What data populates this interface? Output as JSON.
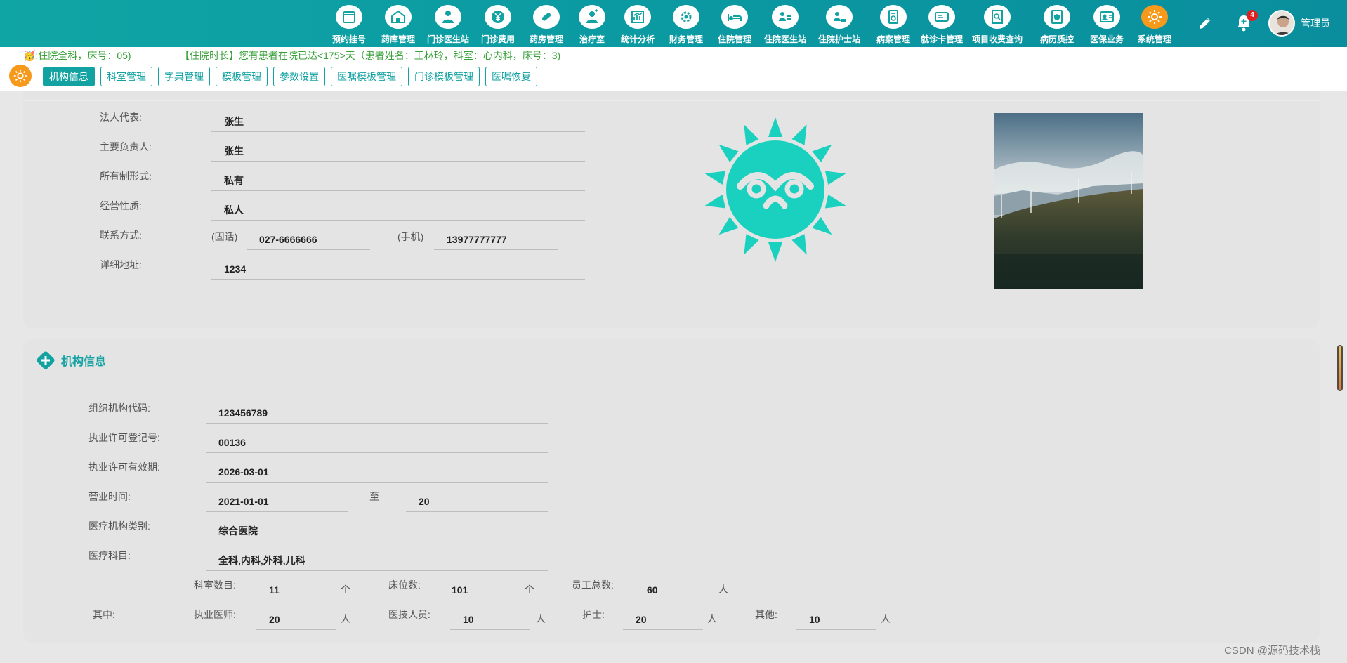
{
  "nav": {
    "items": [
      {
        "label": "预约挂号",
        "icon": "calendar-icon"
      },
      {
        "label": "药库管理",
        "icon": "warehouse-icon"
      },
      {
        "label": "门诊医生站",
        "icon": "doctor-icon"
      },
      {
        "label": "门诊费用",
        "icon": "yen-icon"
      },
      {
        "label": "药房管理",
        "icon": "pill-icon"
      },
      {
        "label": "治疗室",
        "icon": "nurse-icon"
      },
      {
        "label": "统计分析",
        "icon": "chart-icon"
      },
      {
        "label": "财务管理",
        "icon": "finance-gear-icon"
      },
      {
        "label": "住院管理",
        "icon": "bed-icon"
      },
      {
        "label": "住院医生站",
        "icon": "inpatient-doctor-icon"
      },
      {
        "label": "住院护士站",
        "icon": "inpatient-nurse-icon"
      },
      {
        "label": "病案管理",
        "icon": "record-icon"
      },
      {
        "label": "就诊卡管理",
        "icon": "card-icon"
      },
      {
        "label": "项目收费查询",
        "icon": "search-doc-icon"
      },
      {
        "label": "病历质控",
        "icon": "shield-doc-icon"
      },
      {
        "label": "医保业务",
        "icon": "insurance-icon"
      },
      {
        "label": "系统管理",
        "icon": "settings-icon",
        "active": true
      }
    ],
    "notification_count": "4",
    "username": "管理员"
  },
  "marquee": {
    "left": "🥳:住院全科，床号：05)",
    "right": "【住院时长】您有患者在院已达<175>天（患者姓名：王林玲，科室：心内科，床号：3)"
  },
  "tabs": [
    {
      "label": "机构信息",
      "active": true
    },
    {
      "label": "科室管理"
    },
    {
      "label": "字典管理"
    },
    {
      "label": "模板管理"
    },
    {
      "label": "参数设置"
    },
    {
      "label": "医嘱模板管理"
    },
    {
      "label": "门诊模板管理"
    },
    {
      "label": "医嘱恢复"
    }
  ],
  "card1": {
    "legal_rep_label": "法人代表:",
    "legal_rep": "张生",
    "manager_label": "主要负责人:",
    "manager": "张生",
    "ownership_label": "所有制形式:",
    "ownership": "私有",
    "nature_label": "经营性质:",
    "nature": "私人",
    "contact_label": "联系方式:",
    "phone_label": "(固话)",
    "phone": "027-6666666",
    "mobile_label": "(手机)",
    "mobile": "13977777777",
    "address_label": "详细地址:",
    "address": "1234"
  },
  "card2": {
    "title": "机构信息",
    "org_code_label": "组织机构代码:",
    "org_code": "123456789",
    "license_no_label": "执业许可登记号:",
    "license_no": "00136",
    "license_valid_label": "执业许可有效期:",
    "license_valid": "2026-03-01",
    "business_time_label": "营业时间:",
    "business_time_from": "2021-01-01",
    "to_label": "至",
    "business_time_to": "20",
    "category_label": "医疗机构类别:",
    "category": "综合医院",
    "subjects_label": "医疗科目:",
    "subjects": "全科,内科,外科,儿科",
    "dept_count_label": "科室数目:",
    "dept_count": "11",
    "unit_ge": "个",
    "bed_count_label": "床位数:",
    "bed_count": "101",
    "staff_total_label": "员工总数:",
    "staff_total": "60",
    "unit_ren": "人",
    "of_which_label": "其中:",
    "doctors_label": "执业医师:",
    "doctors": "20",
    "technicians_label": "医技人员:",
    "technicians": "10",
    "nurses_label": "护士:",
    "nurses": "20",
    "others_label": "其他:",
    "others": "10"
  },
  "watermark": "CSDN @源码技术栈",
  "colors": {
    "primary": "#13a2a2",
    "accent_orange": "#f79a1c",
    "logo": "#1ad1bf",
    "badge": "#e02020"
  }
}
